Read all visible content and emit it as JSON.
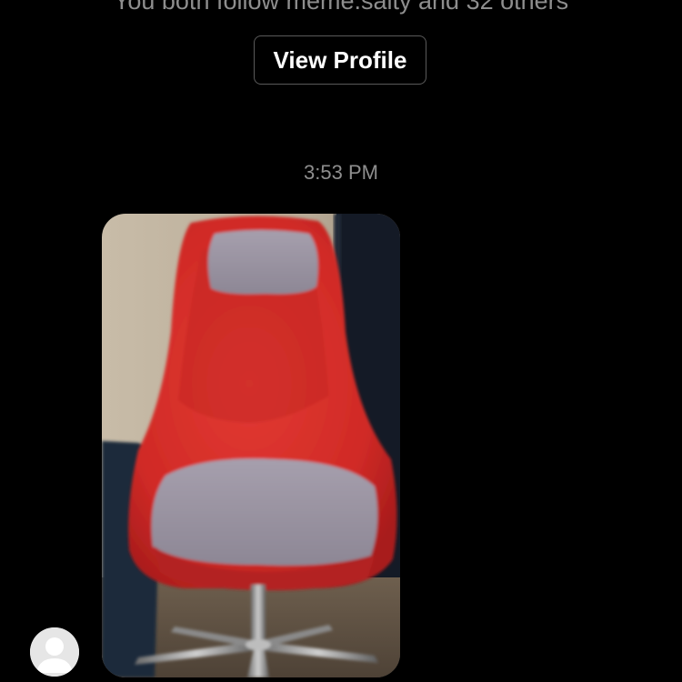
{
  "thread": {
    "mutual_followers_text": "You both follow meme.salty and 32 others",
    "view_profile_label": "View Profile",
    "timestamp": "3:53 PM"
  },
  "message": {
    "type": "photo",
    "photo_subject": "red-swivel-chair-photo"
  },
  "colors": {
    "background": "#000000",
    "secondary_text": "#8e8e8e",
    "button_border": "#5a5a5a",
    "button_text": "#ffffff",
    "avatar_background": "#e6e6e6"
  },
  "icons": {
    "avatar": "default-user-avatar-icon"
  }
}
